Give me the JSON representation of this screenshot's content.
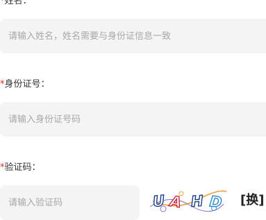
{
  "form": {
    "name": {
      "required_mark": "*",
      "label": "姓名：",
      "placeholder": "请输入姓名，姓名需要与身份证信息一致"
    },
    "id_number": {
      "required_mark": "*",
      "label": "身份证号：",
      "placeholder": "请输入身份证号码"
    },
    "captcha": {
      "required_mark": "*",
      "label": "验证码：",
      "placeholder": "请输入验证码",
      "image_text": "UAHD",
      "refresh_label": "[换]"
    }
  },
  "colors": {
    "required": "#e0261b",
    "input_bg": "#f4f4f4",
    "placeholder": "#a8a8a8"
  }
}
